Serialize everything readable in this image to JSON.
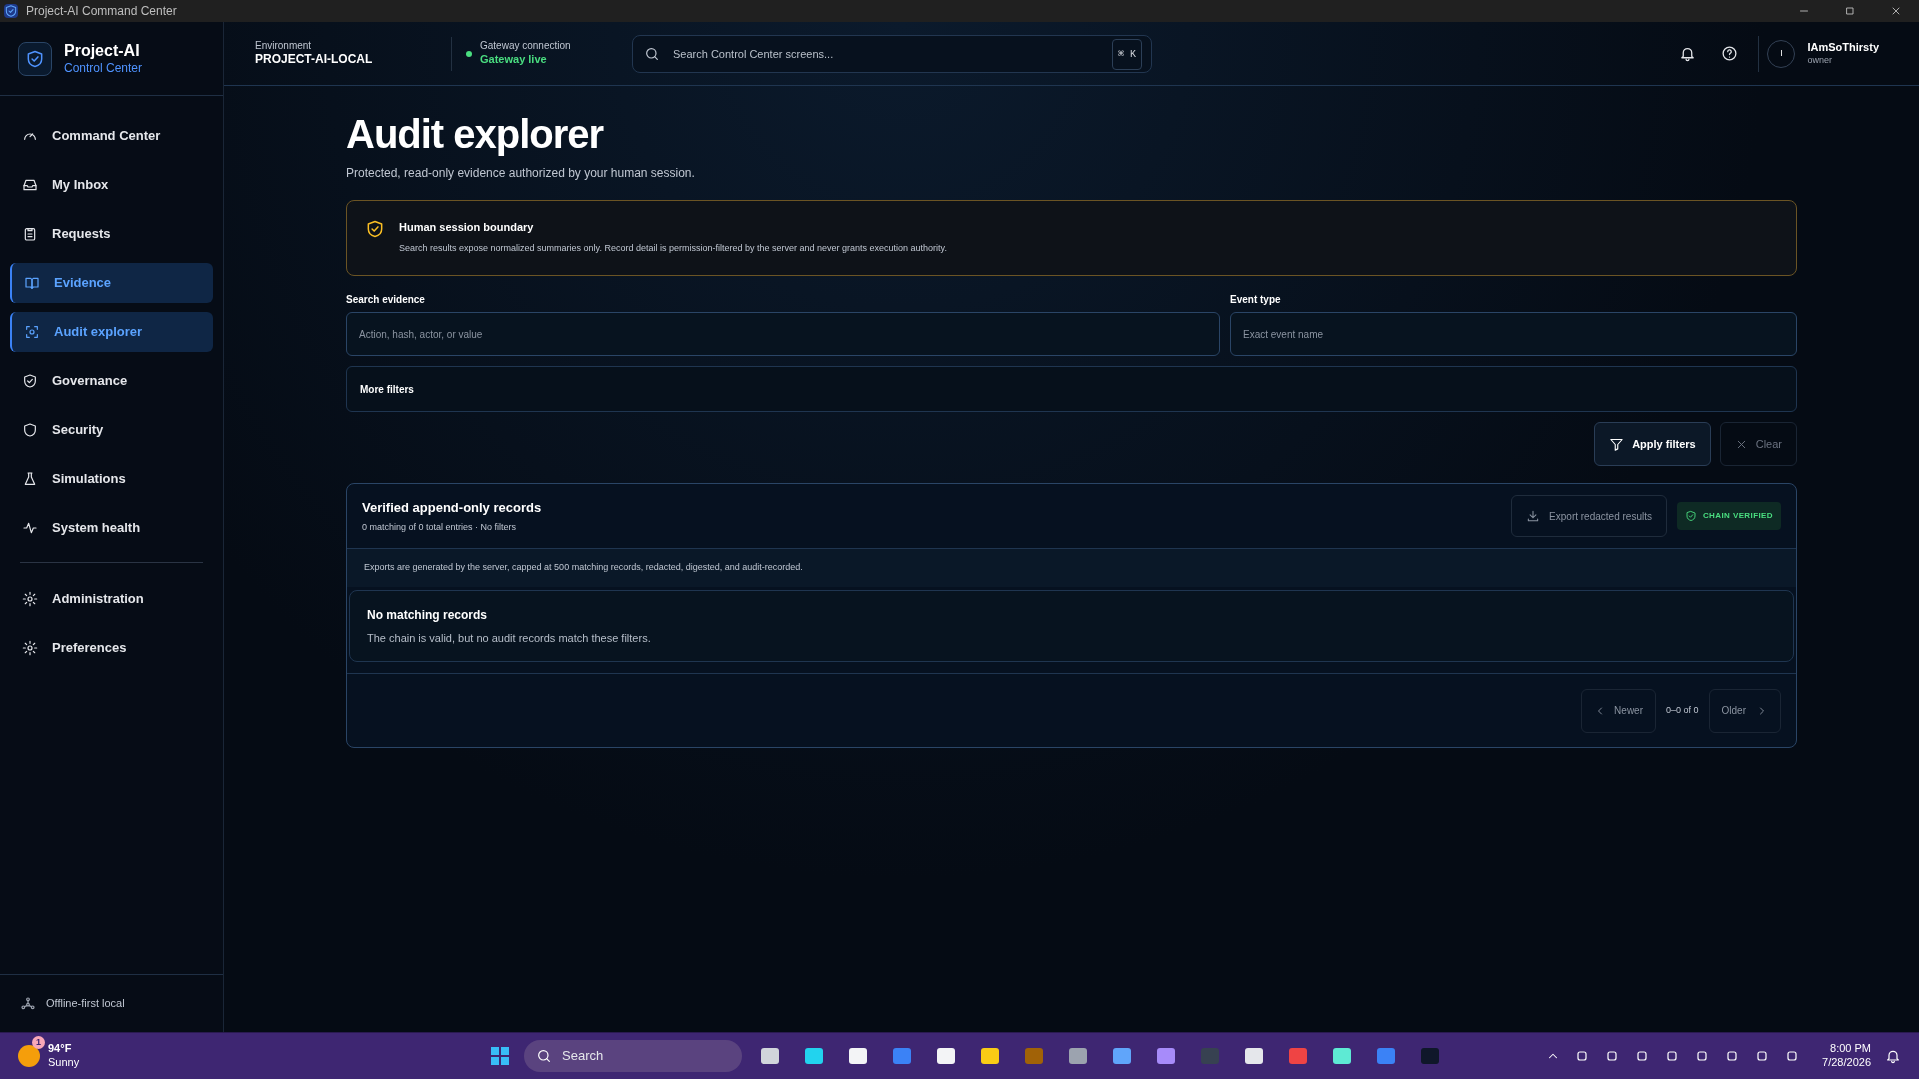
{
  "window": {
    "title": "Project-AI Command Center"
  },
  "brand": {
    "name": "Project-AI",
    "subtitle": "Control Center"
  },
  "sidebar": {
    "groups": [
      [
        {
          "label": "Command Center",
          "selected": false
        },
        {
          "label": "My Inbox",
          "selected": false
        },
        {
          "label": "Requests",
          "selected": false
        },
        {
          "label": "Evidence",
          "selected": true
        },
        {
          "label": "Audit explorer",
          "selected": true
        },
        {
          "label": "Governance",
          "selected": false
        },
        {
          "label": "Security",
          "selected": false
        },
        {
          "label": "Simulations",
          "selected": false
        },
        {
          "label": "System health",
          "selected": false
        }
      ],
      [
        {
          "label": "Administration",
          "selected": false
        },
        {
          "label": "Preferences",
          "selected": false
        }
      ]
    ],
    "footer": "Offline-first local"
  },
  "header": {
    "environment_label": "Environment",
    "environment": "PROJECT-AI-LOCAL",
    "gateway_label": "Gateway connection",
    "gateway_status": "Gateway live",
    "gateway_live": true,
    "search_placeholder": "Search Control Center screens...",
    "shortcut": "⌘ K",
    "user_initial": "I",
    "user_name": "IAmSoThirsty",
    "user_role": "owner"
  },
  "page": {
    "title": "Audit explorer",
    "subtitle": "Protected, read-only evidence authorized by your human session.",
    "notice": {
      "title": "Human session boundary",
      "text": "Search results expose normalized summaries only. Record detail is permission-filtered by the server and never grants execution authority."
    },
    "filters": [
      {
        "label": "Search evidence",
        "placeholder": "Action, hash, actor, or value"
      },
      {
        "label": "Event type",
        "placeholder": "Exact event name"
      }
    ],
    "more_filters": "More filters",
    "apply_button": "Apply filters",
    "clear_button": "Clear",
    "records": {
      "title": "Verified append-only records",
      "summary": "0 matching of 0 total entries · No filters",
      "export_button": "Export redacted results",
      "chain_badge": "CHAIN VERIFIED",
      "export_note": "Exports are generated by the server, capped at 500 matching records, redacted, digested, and audit-recorded.",
      "empty_title": "No matching records",
      "empty_text": "The chain is valid, but no audit records match these filters.",
      "newer_button": "Newer",
      "range": "0–0 of 0",
      "older_button": "Older"
    }
  },
  "taskbar": {
    "temperature": "94°F",
    "weather": "Sunny",
    "weather_badge": "1",
    "search": "Search",
    "time": "8:00 PM",
    "date": "7/28/2026"
  }
}
